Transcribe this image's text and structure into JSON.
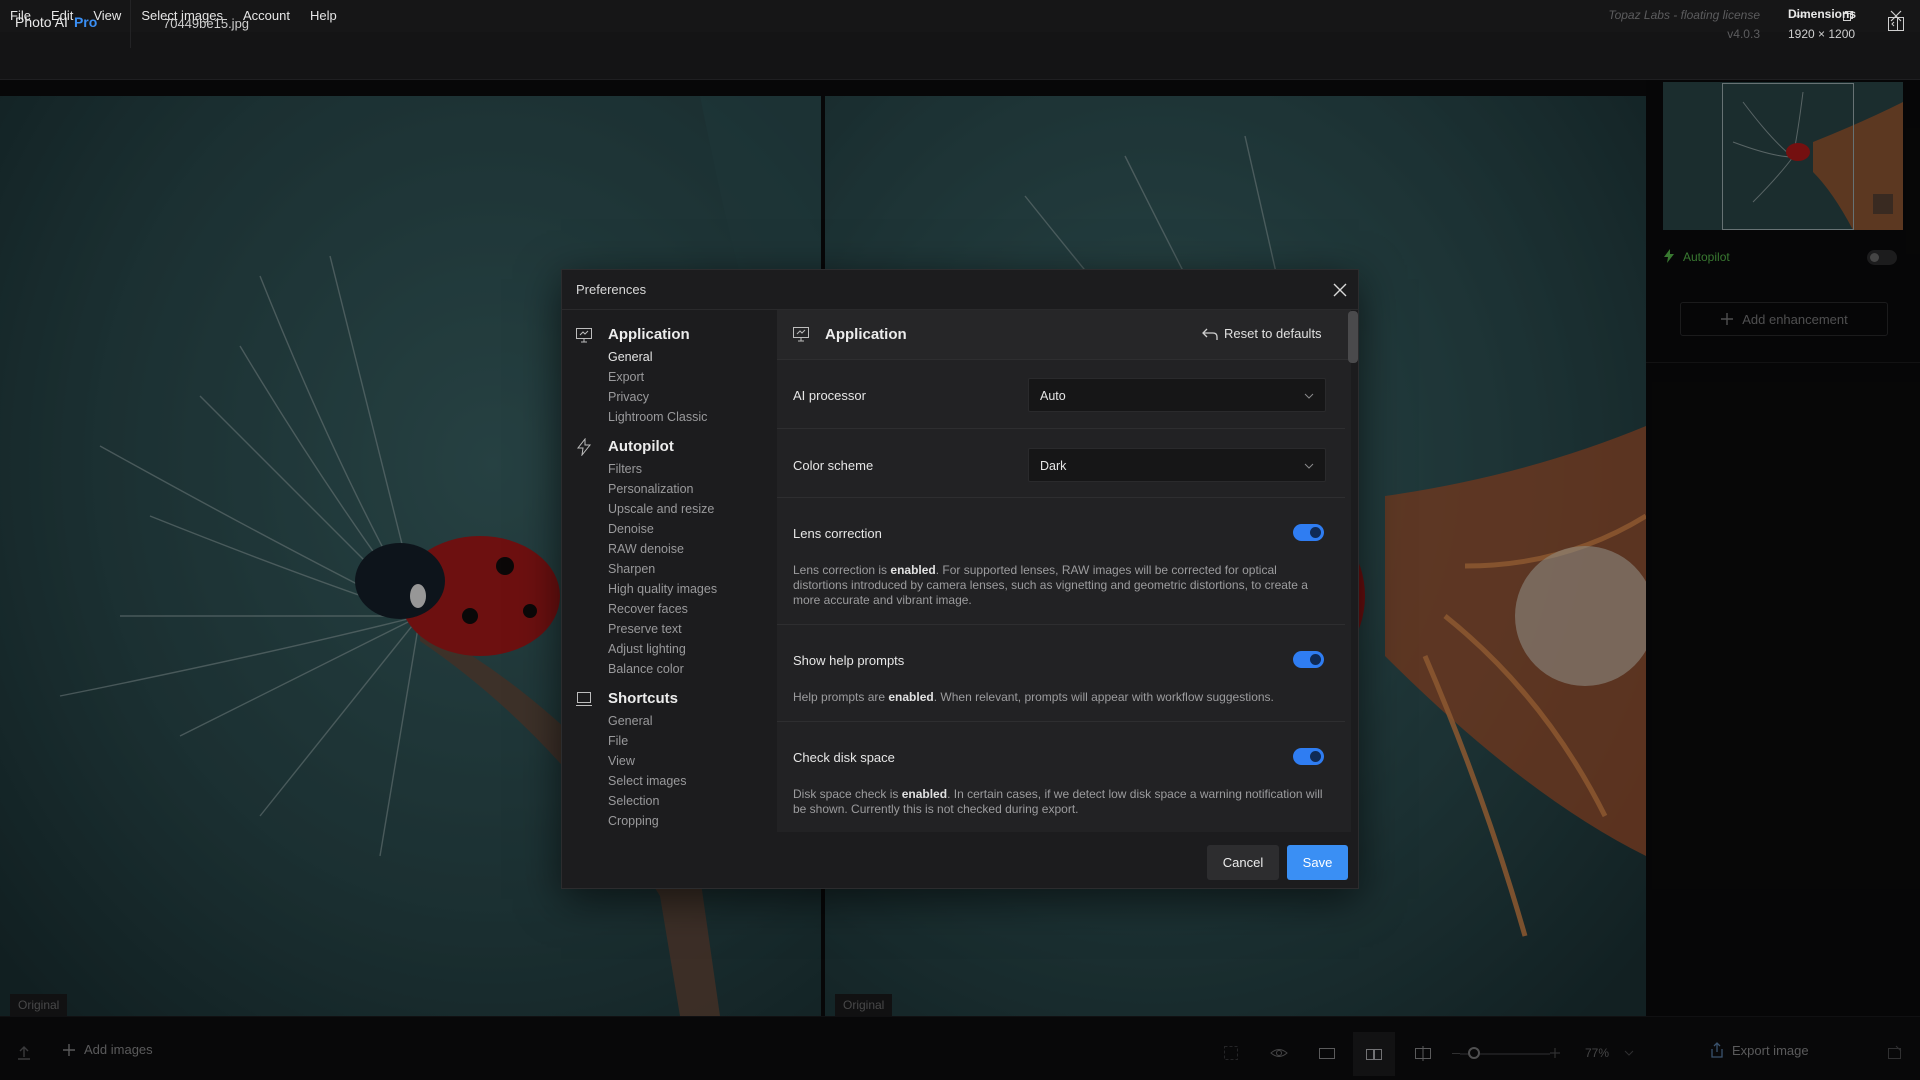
{
  "menu": [
    "File",
    "Edit",
    "View",
    "Select images",
    "Account",
    "Help"
  ],
  "header": {
    "app_name": "Photo AI",
    "app_tier": "Pro",
    "filename": "70449be15.jpg",
    "license": "Topaz Labs - floating license",
    "version": "v4.0.3",
    "dimensions_label": "Dimensions",
    "dimensions_value": "1920 × 1200"
  },
  "panes": {
    "left_label": "Original",
    "right_label": "Original"
  },
  "right_panel": {
    "autopilot_label": "Autopilot",
    "autopilot_enabled": false,
    "add_enhancement": "Add enhancement"
  },
  "bottom_bar": {
    "add_images": "Add images",
    "zoom": "77%",
    "export": "Export image"
  },
  "dialog": {
    "title": "Preferences",
    "nav": {
      "application": {
        "heading": "Application",
        "items": [
          "General",
          "Export",
          "Privacy",
          "Lightroom Classic"
        ]
      },
      "autopilot": {
        "heading": "Autopilot",
        "items": [
          "Filters",
          "Personalization",
          "Upscale and resize",
          "Denoise",
          "RAW denoise",
          "Sharpen",
          "High quality images",
          "Recover faces",
          "Preserve text",
          "Adjust lighting",
          "Balance color"
        ]
      },
      "shortcuts": {
        "heading": "Shortcuts",
        "items": [
          "General",
          "File",
          "View",
          "Select images",
          "Selection",
          "Cropping"
        ]
      }
    },
    "content": {
      "title": "Application",
      "reset": "Reset to defaults",
      "ai_processor_label": "AI processor",
      "ai_processor_value": "Auto",
      "color_scheme_label": "Color scheme",
      "color_scheme_value": "Dark",
      "lens_correction": {
        "label": "Lens correction",
        "enabled": true,
        "desc_pre": "Lens correction is ",
        "desc_bold": "enabled",
        "desc_post": ". For supported lenses, RAW images will be corrected for optical distortions introduced by camera lenses, such as vignetting and geometric distortions, to create a more accurate and vibrant image."
      },
      "help_prompts": {
        "label": "Show help prompts",
        "enabled": true,
        "desc_pre": "Help prompts are ",
        "desc_bold": "enabled",
        "desc_post": ". When relevant, prompts will appear with workflow suggestions."
      },
      "disk_space": {
        "label": "Check disk space",
        "enabled": true,
        "desc_pre": "Disk space check is ",
        "desc_bold": "enabled",
        "desc_post": ". In certain cases, if we detect low disk space a warning notification will be shown. Currently this is not checked during export."
      }
    },
    "cancel": "Cancel",
    "save": "Save"
  },
  "colors": {
    "accent": "#3a8ff4",
    "autopilot_green": "#57b84b",
    "dialog_bg": "#1c1c1e"
  }
}
